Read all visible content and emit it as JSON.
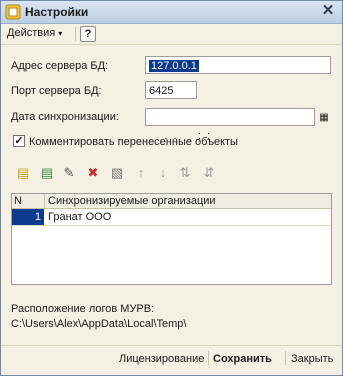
{
  "window": {
    "title": "Настройки"
  },
  "menu": {
    "actions_label": "Действия",
    "help_label": "?"
  },
  "form": {
    "server_address_label": "Адрес сервера БД:",
    "server_address_value": "127.0.0.1",
    "server_port_label": "Порт сервера БД:",
    "server_port_value": "6425",
    "sync_date_label": "Дата синхронизации:",
    "sync_date_value": " .  .       :  :",
    "comment_checkbox_label": "Комментировать перенесенные объекты",
    "comment_checkbox_checked": true
  },
  "toolbar": {
    "icons": [
      "add-row-icon",
      "add-copy-icon",
      "edit-icon",
      "delete-icon",
      "edit-alt-icon",
      "move-up-icon",
      "move-down-icon",
      "sort-asc-icon",
      "sort-desc-icon"
    ]
  },
  "table": {
    "headers": [
      "N",
      "Синхронизируемые организации"
    ],
    "rows": [
      {
        "n": "1",
        "org": "Гранат ООО"
      }
    ]
  },
  "logs": {
    "label": "Расположение логов МУРВ:",
    "path": "C:\\Users\\Alex\\AppData\\Local\\Temp\\"
  },
  "footer": {
    "license_label": "Лицензирование",
    "save_label": "Сохранить",
    "close_label": "Закрыть"
  },
  "colors": {
    "accent": "#0b3a8f",
    "title_bg": "#bccfe3",
    "window_bg": "#f4f1e4"
  }
}
